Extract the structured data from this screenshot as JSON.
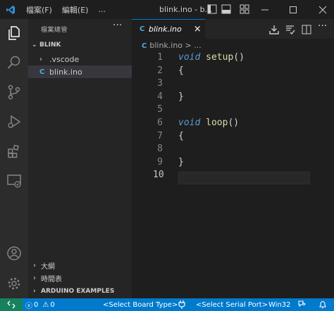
{
  "titlebar": {
    "menu": [
      "檔案(F)",
      "編輯(E)",
      "..."
    ],
    "title": "blink.ino - b..."
  },
  "sidebar": {
    "title": "檔案總管",
    "more": "···",
    "folder": "BLINK",
    "items": [
      ".vscode",
      "blink.ino"
    ],
    "sections": [
      "大綱",
      "時間表",
      "ARDUINO EXAMPLES"
    ]
  },
  "editor": {
    "tab_label": "blink.ino",
    "close": "×",
    "breadcrumb": "blink.ino > ...",
    "lines": [
      {
        "n": "1",
        "tokens": [
          [
            "kw",
            "void"
          ],
          [
            "pn",
            " "
          ],
          [
            "fn",
            "setup"
          ],
          [
            "pn",
            "()"
          ]
        ]
      },
      {
        "n": "2",
        "tokens": [
          [
            "pn",
            "{"
          ]
        ]
      },
      {
        "n": "3",
        "tokens": []
      },
      {
        "n": "4",
        "tokens": [
          [
            "pn",
            "}"
          ]
        ]
      },
      {
        "n": "5",
        "tokens": []
      },
      {
        "n": "6",
        "tokens": [
          [
            "kw",
            "void"
          ],
          [
            "pn",
            " "
          ],
          [
            "fn",
            "loop"
          ],
          [
            "pn",
            "()"
          ]
        ]
      },
      {
        "n": "7",
        "tokens": [
          [
            "pn",
            "{"
          ]
        ]
      },
      {
        "n": "8",
        "tokens": []
      },
      {
        "n": "9",
        "tokens": [
          [
            "pn",
            "}"
          ]
        ]
      },
      {
        "n": "10",
        "tokens": []
      }
    ],
    "active_line": "10"
  },
  "status": {
    "errors": "0",
    "warnings": "0",
    "board": "<Select Board Type>",
    "port": "<Select Serial Port>",
    "platform": "Win32"
  },
  "colors": {
    "accent": "#0078d4",
    "statusbar": "#007acc",
    "remote": "#16825d",
    "keyword": "#569cd6",
    "function": "#dcdcaa"
  }
}
